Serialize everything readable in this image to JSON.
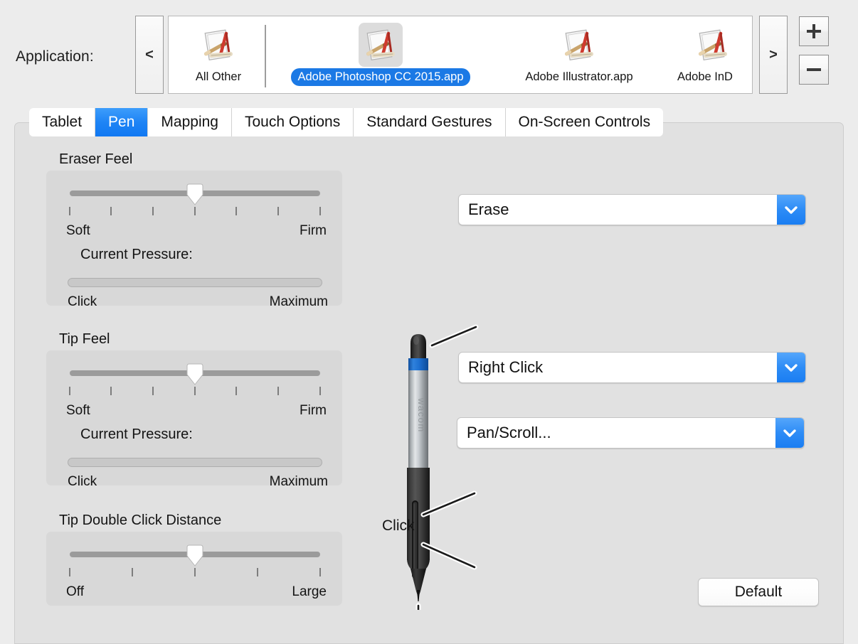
{
  "app_bar": {
    "label": "Application:",
    "prev_label": "<",
    "next_label": ">",
    "add_label": "+",
    "remove_label": "−",
    "apps": [
      {
        "name": "All Other",
        "selected": false
      },
      {
        "name": "Adobe Photoshop CC 2015.app",
        "selected": true
      },
      {
        "name": "Adobe Illustrator.app",
        "selected": false
      },
      {
        "name": "Adobe InD",
        "selected": false
      }
    ]
  },
  "tabs": [
    {
      "label": "Tablet",
      "active": false
    },
    {
      "label": "Pen",
      "active": true
    },
    {
      "label": "Mapping",
      "active": false
    },
    {
      "label": "Touch Options",
      "active": false
    },
    {
      "label": "Standard Gestures",
      "active": false
    },
    {
      "label": "On-Screen Controls",
      "active": false
    }
  ],
  "groups": {
    "eraser_feel": {
      "title": "Eraser Feel",
      "slider_min_label": "Soft",
      "slider_max_label": "Firm",
      "slider_value_percent": 50,
      "tick_count": 7,
      "pressure_title": "Current Pressure:",
      "pressure_min_label": "Click",
      "pressure_max_label": "Maximum",
      "pressure_value_percent": 0
    },
    "tip_feel": {
      "title": "Tip Feel",
      "slider_min_label": "Soft",
      "slider_max_label": "Firm",
      "slider_value_percent": 50,
      "tick_count": 7,
      "pressure_title": "Current Pressure:",
      "pressure_min_label": "Click",
      "pressure_max_label": "Maximum",
      "pressure_value_percent": 0
    },
    "tip_double_click_distance": {
      "title": "Tip Double Click Distance",
      "slider_min_label": "Off",
      "slider_max_label": "Large",
      "slider_value_percent": 50,
      "tick_count": 5
    }
  },
  "pen_mappings": {
    "eraser": {
      "value": "Erase"
    },
    "upper_button": {
      "value": "Right Click"
    },
    "lower_button": {
      "value": "Pan/Scroll..."
    },
    "tip": {
      "label": "Click"
    }
  },
  "buttons": {
    "default": "Default"
  },
  "icons": {
    "chevron_down": "chevron-down-icon",
    "app_generic": "generic-app-icon"
  },
  "colors": {
    "accent_blue": "#1b79e5",
    "dropdown_blue": "#2d8cf6",
    "panel_bg": "#e1e1e1",
    "group_bg": "#d8d8d8",
    "window_bg": "#ececec",
    "pen_accent": "#1b6fd4"
  }
}
